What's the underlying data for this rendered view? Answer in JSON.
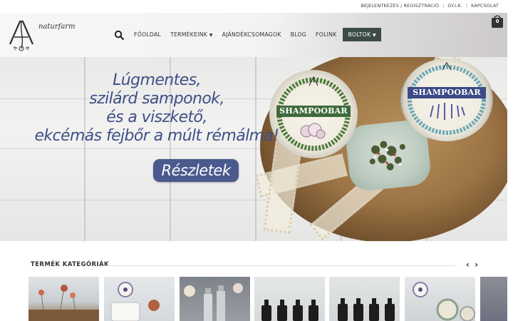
{
  "top_links": {
    "login": "BEJELENTKEZÉS / REGISZTRÁCIÓ",
    "faq": "GY.I.K.",
    "contact": "KAPCSOLAT"
  },
  "logo": {
    "text": "naturfarm"
  },
  "nav": {
    "items": [
      "FŐOLDAL",
      "TERMÉKEINK",
      "AJÁNDÉKCSOMAGOK",
      "BLOG",
      "FOLINK",
      "BOLTOK"
    ],
    "active": "BOLTOK"
  },
  "cart": {
    "count": "0"
  },
  "hero": {
    "headline_lines": [
      "Lúgmentes,",
      "szilárd samponok,",
      "és a viszkető,",
      "ekcémás fejbőr a múlt rémálma!"
    ],
    "button_label": "Részletek",
    "tin_left_label": "SHAMPOOBAR",
    "tin_right_label": "SHAMPOOBAR"
  },
  "categories": {
    "title": "TERMÉK KATEGÓRIÁK",
    "prev_icon": "chevron-left-icon",
    "next_icon": "chevron-right-icon"
  },
  "colors": {
    "headline": "#3f4f86",
    "button": "#4a5a8e",
    "nav_active": "#3d4b47"
  }
}
